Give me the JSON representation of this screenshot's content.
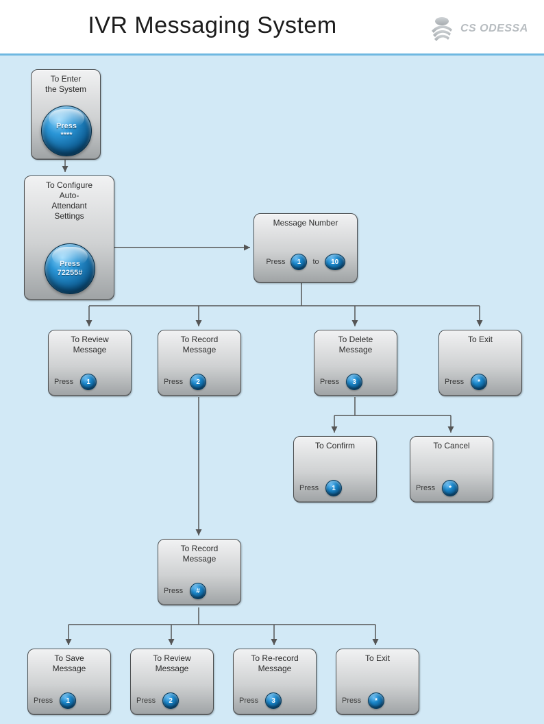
{
  "header": {
    "title": "IVR Messaging System",
    "logo_text": "CS ODESSA"
  },
  "press_label": "Press",
  "to_label": "to",
  "nodes": {
    "enter": {
      "title": "To Enter\nthe System",
      "big_press_label": "Press",
      "big_press_code": "****"
    },
    "configure": {
      "title": "To Configure\nAuto-\nAttendant\nSettings",
      "big_press_label": "Press",
      "big_press_code": "72255#"
    },
    "msg_number": {
      "title": "Message Number",
      "key_from": "1",
      "key_to": "10"
    },
    "review": {
      "title": "To Review\nMessage",
      "key": "1"
    },
    "record": {
      "title": "To Record\nMessage",
      "key": "2"
    },
    "delete": {
      "title": "To Delete\nMessage",
      "key": "3"
    },
    "exit1": {
      "title": "To Exit",
      "key": "*"
    },
    "confirm": {
      "title": "To Confirm",
      "key": "1"
    },
    "cancel": {
      "title": "To Cancel",
      "key": "*"
    },
    "record2": {
      "title": "To Record\nMessage",
      "key": "#"
    },
    "save": {
      "title": "To Save\nMessage",
      "key": "1"
    },
    "review2": {
      "title": "To Review\nMessage",
      "key": "2"
    },
    "rerecord": {
      "title": "To Re-record\nMessage",
      "key": "3"
    },
    "exit2": {
      "title": "To Exit",
      "key": "*"
    }
  }
}
